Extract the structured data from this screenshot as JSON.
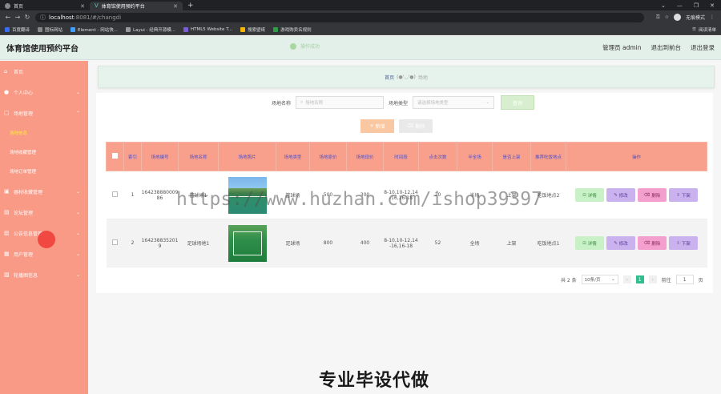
{
  "browser": {
    "tabs": [
      {
        "label": "首页",
        "active": false
      },
      {
        "label": "体育馆使用预约平台",
        "active": true
      }
    ],
    "new_tab": "+",
    "url_host": "localhost",
    "url_rest": ":8081/#/changdi",
    "incognito_label": "无痕模式",
    "bookmarks": [
      "百度翻译",
      "图标网站",
      "Element - 网站快...",
      "Layui - 经典开源模...",
      "HTML5 Website T...",
      "搜索壁纸",
      "游戏购卖名规则"
    ],
    "bookmarks_right": "阅读清单"
  },
  "header": {
    "title": "体育馆使用预约平台",
    "toast": "操作成功",
    "user": "管理员 admin",
    "to_front": "退出到前台",
    "logout": "退出登录"
  },
  "sidebar": {
    "items": [
      {
        "label": "首页",
        "icon": "home-icon"
      },
      {
        "label": "个人中心",
        "icon": "user-icon"
      },
      {
        "label": "场地管理",
        "icon": "grid-icon"
      },
      {
        "label": "场地信息",
        "sub": true,
        "active": true
      },
      {
        "label": "场地收藏管理",
        "sub": true
      },
      {
        "label": "场地订单管理",
        "sub": true
      },
      {
        "label": "器材收藏管理",
        "icon": "box-icon"
      },
      {
        "label": "论坛管理",
        "icon": "chat-icon"
      },
      {
        "label": "公告信息管理",
        "icon": "notice-icon"
      },
      {
        "label": "用户管理",
        "icon": "users-icon"
      },
      {
        "label": "轮播图信息",
        "icon": "image-icon"
      }
    ]
  },
  "breadcrumb": {
    "home": "首页",
    "face": "(●'◡'●)",
    "current": "场地"
  },
  "search": {
    "name_label": "场地名称",
    "name_placeholder": "场地名称",
    "type_label": "场地类型",
    "type_placeholder": "请选择场地类型",
    "search_button": "查询"
  },
  "actions": {
    "add": "新增",
    "delete": "删除"
  },
  "table": {
    "headers": [
      "索引",
      "场地编号",
      "场地名称",
      "场地照片",
      "场地类型",
      "场地原价",
      "场地现价",
      "时间段",
      "点击次数",
      "半全场",
      "是否上架",
      "推荐吃饭地点",
      "操作"
    ],
    "rows": [
      {
        "index": "1",
        "code": "16423888000986",
        "name": "篮球场1",
        "type": "篮球场",
        "orig": "500",
        "price": "300",
        "time": "8-10,10-12,14-16,16-18",
        "clicks": "20",
        "half": "半场",
        "shelf": "上架",
        "place": "吃饭地点2"
      },
      {
        "index": "2",
        "code": "1642388352019",
        "name": "足球场地1",
        "type": "足球场",
        "orig": "800",
        "price": "400",
        "time": "8-10,10-12,14-16,16-18",
        "clicks": "52",
        "half": "全场",
        "shelf": "上架",
        "place": "吃饭地点1"
      }
    ],
    "ops": {
      "detail": "详情",
      "edit": "修改",
      "remove": "删除",
      "offline": "下架"
    }
  },
  "pager": {
    "total": "共 2 条",
    "size": "10条/页",
    "current": "1",
    "goto": "前往",
    "page_input": "1",
    "unit": "页"
  },
  "watermark": "https://www.huzhan.com/ishop39397",
  "promo": "专业毕设代做"
}
